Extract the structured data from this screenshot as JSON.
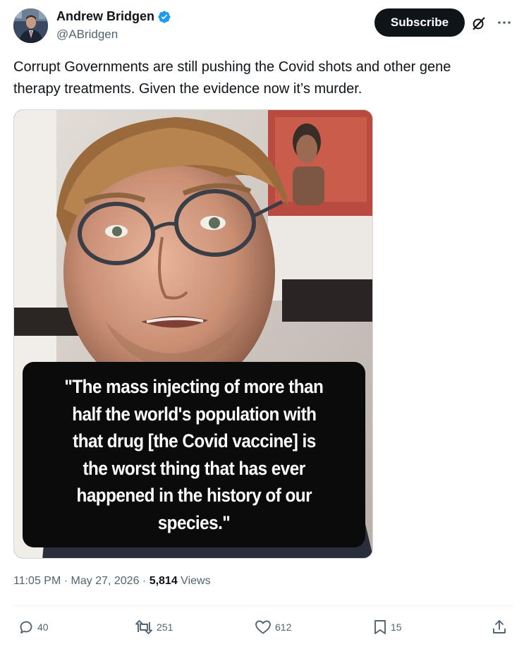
{
  "author": {
    "display_name": "Andrew Bridgen",
    "handle": "@ABridgen",
    "verified": true,
    "avatar_icon": "profile-photo"
  },
  "header": {
    "subscribe_label": "Subscribe",
    "grok_icon": "grok-icon",
    "more_icon": "more-dots-icon"
  },
  "tweet": {
    "text_lines": [
      "Corrupt Governments are still pushing the Covid shots and other gene",
      "therapy treatments. Given the evidence now it’s murder."
    ]
  },
  "media": {
    "caption_lines": [
      "\"The mass injecting of more than",
      "half the world's population with",
      "that drug [the Covid vaccine] is",
      "the worst thing that has ever",
      "happened in the history of our",
      "species.\""
    ]
  },
  "meta": {
    "time": "11:05 PM",
    "separator": " · ",
    "date": "May 27, 2026",
    "views_count": "5,814",
    "views_label": " Views"
  },
  "actions": {
    "replies": "40",
    "reposts": "251",
    "likes": "612",
    "bookmarks": "15"
  },
  "colors": {
    "text_primary": "#0f1419",
    "text_secondary": "#536471",
    "verified_blue": "#1d9bf0",
    "divider": "#eff3f4"
  }
}
